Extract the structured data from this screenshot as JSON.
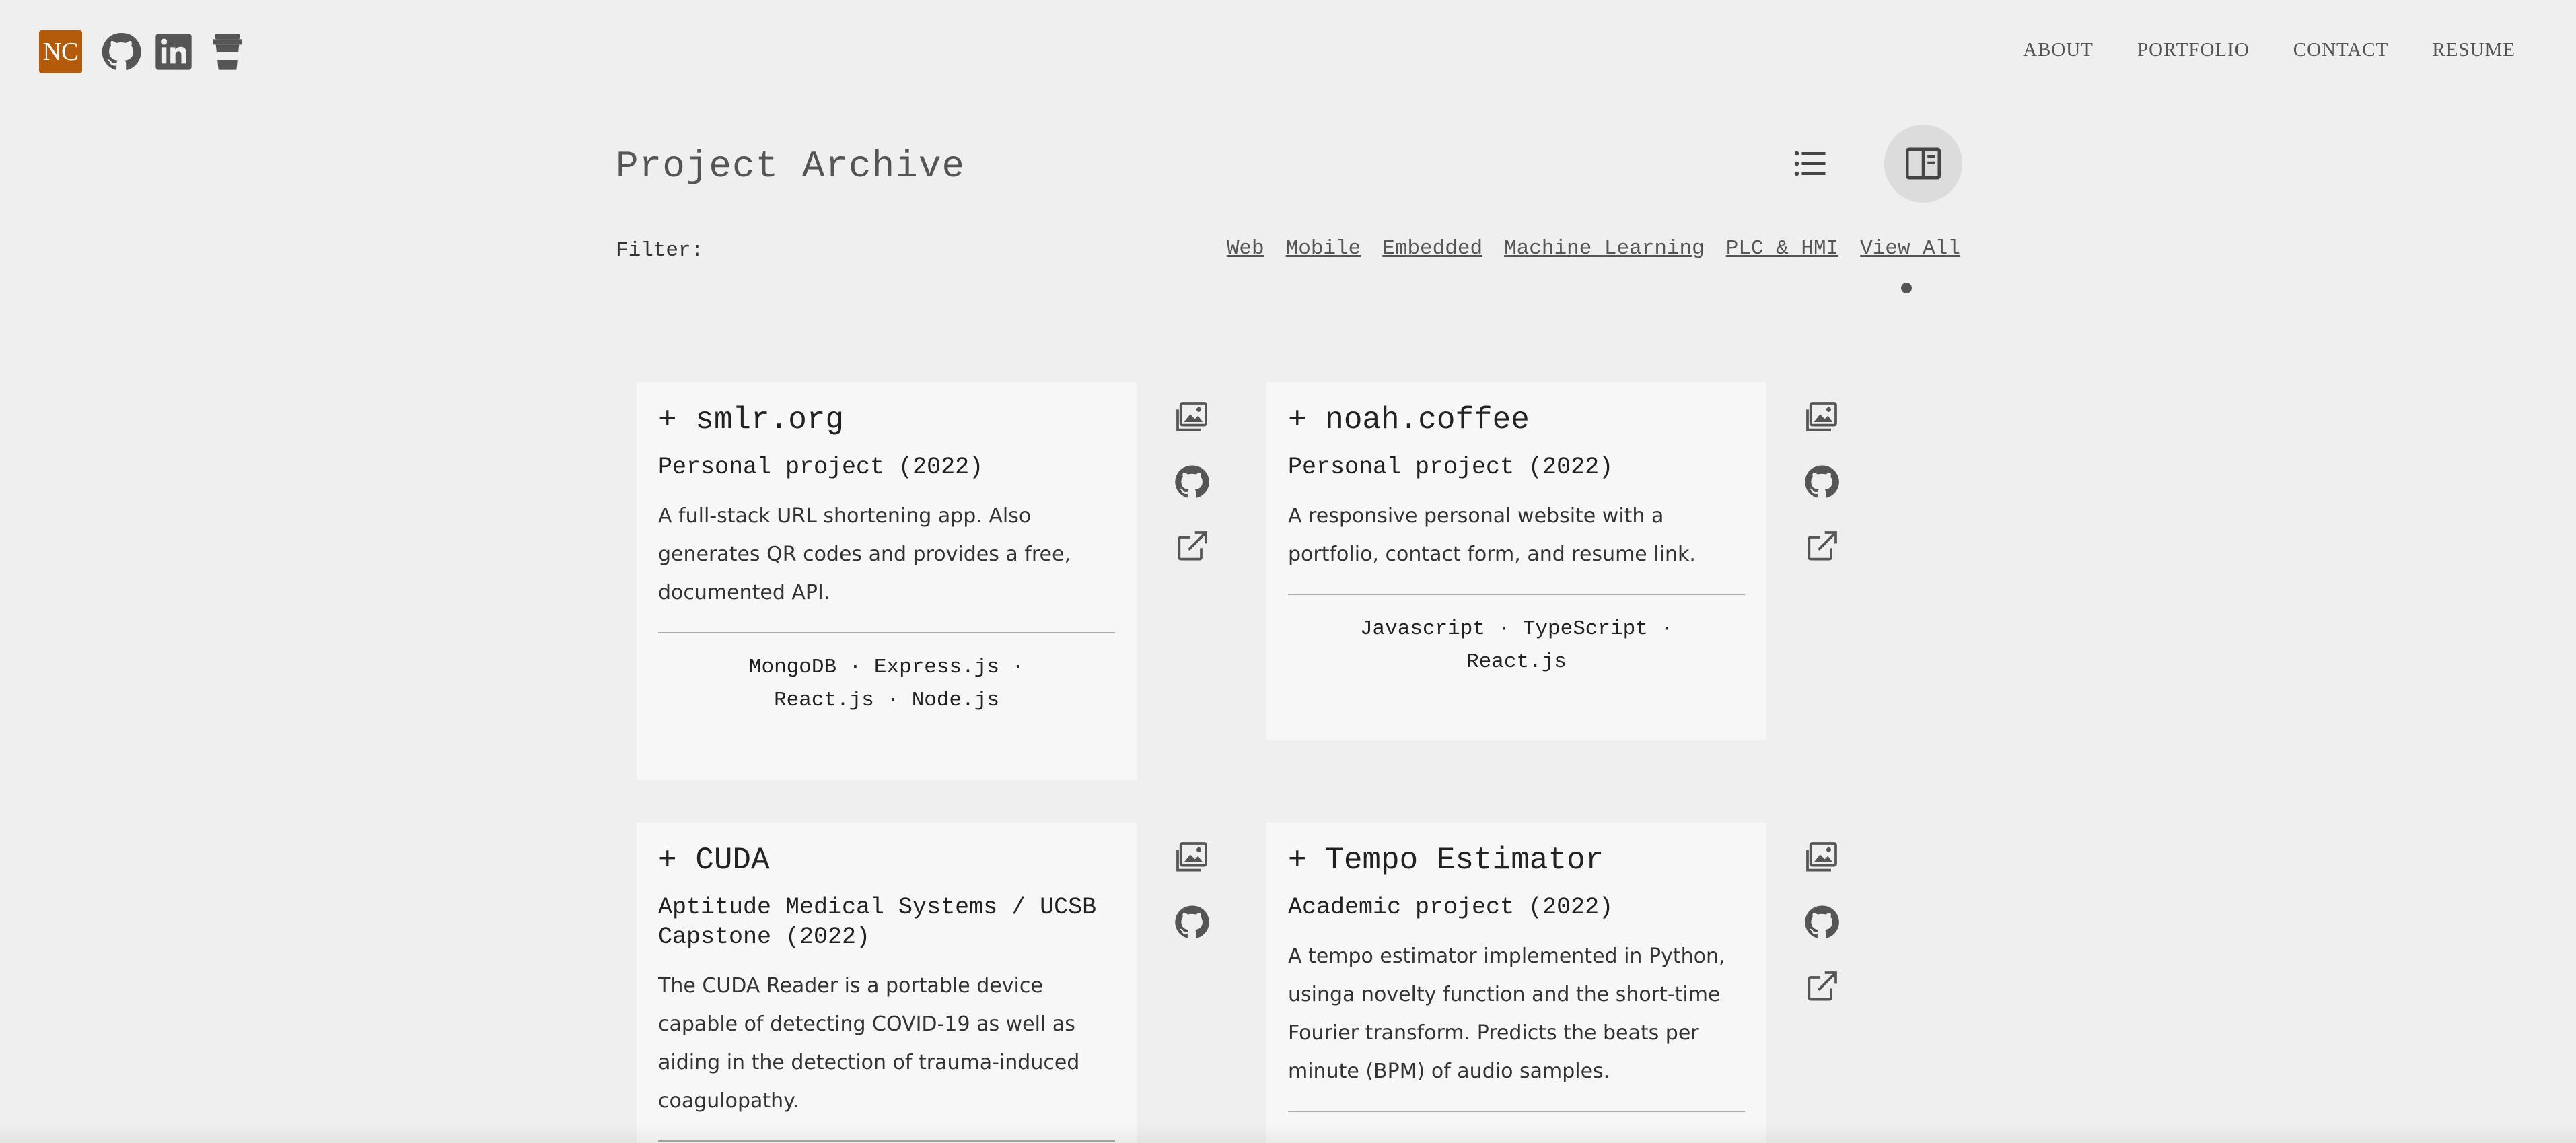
{
  "header": {
    "logo_text": "NC",
    "social_icons": [
      "github-icon",
      "linkedin-icon",
      "coffee-cup-icon"
    ],
    "nav": [
      "ABOUT",
      "PORTFOLIO",
      "CONTACT",
      "RESUME"
    ]
  },
  "archive": {
    "title": "Project Archive",
    "view_modes": [
      "list-view-icon",
      "card-view-icon"
    ],
    "active_view": "card-view-icon",
    "filter_label": "Filter:",
    "filters": [
      "Web",
      "Mobile",
      "Embedded",
      "Machine Learning",
      "PLC & HMI",
      "View All"
    ],
    "active_filter": "View All"
  },
  "projects": [
    {
      "title": "+ smlr.org",
      "subtitle": "Personal project (2022)",
      "description": "A full-stack URL shortening app. Also generates QR codes and provides a free, documented API.",
      "tags_line1": "MongoDB  · Express.js  ·",
      "tags_line2": "React.js  · Node.js",
      "icons": [
        "gallery-icon",
        "github-icon",
        "external-link-icon"
      ]
    },
    {
      "title": "+ noah.coffee",
      "subtitle": "Personal project (2022)",
      "description": "A responsive personal website with a portfolio, contact form, and resume link.",
      "tags_line1": "Javascript  · TypeScript  ·",
      "tags_line2": "React.js",
      "icons": [
        "gallery-icon",
        "github-icon",
        "external-link-icon"
      ]
    },
    {
      "title": "+ CUDA",
      "subtitle": "Aptitude Medical Systems / UCSB Capstone (2022)",
      "description": "The CUDA Reader is a portable device capable of detecting COVID-19 as well as aiding in the detection of trauma-induced coagulopathy.",
      "icons": [
        "gallery-icon",
        "github-icon"
      ]
    },
    {
      "title": "+ Tempo Estimator",
      "subtitle": "Academic project (2022)",
      "description": "A tempo estimator implemented in Python, usinga novelty function and the short-time Fourier transform. Predicts the beats per minute (BPM) of audio samples.",
      "icons": [
        "gallery-icon",
        "github-icon",
        "external-link-icon"
      ]
    }
  ],
  "colors": {
    "logo_bg": "#b35a0b",
    "page_bg": "#efefef",
    "card_bg": "#f7f7f7"
  }
}
